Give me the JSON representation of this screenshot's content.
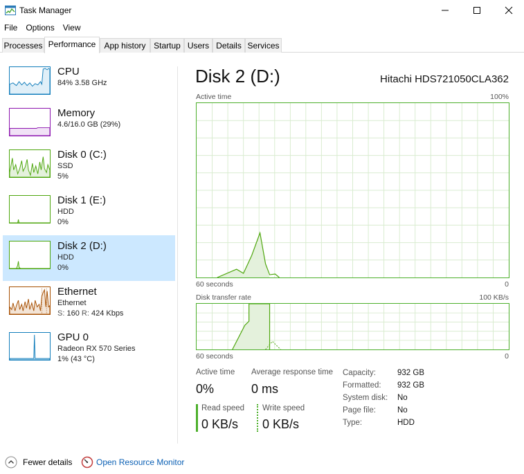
{
  "window": {
    "title": "Task Manager",
    "icon": "task-manager-icon",
    "controls": [
      "minimize-icon",
      "maximize-icon",
      "close-icon"
    ]
  },
  "menu": [
    "File",
    "Options",
    "View"
  ],
  "tabs": [
    "Processes",
    "Performance",
    "App history",
    "Startup",
    "Users",
    "Details",
    "Services"
  ],
  "active_tab": "Performance",
  "sidebar": [
    {
      "title": "CPU",
      "line1": "84%  3.58 GHz",
      "line2": "",
      "color": "#117dbb"
    },
    {
      "title": "Memory",
      "line1": "4.6/16.0 GB (29%)",
      "line2": "",
      "color": "#8b12ae"
    },
    {
      "title": "Disk 0 (C:)",
      "line1": "SSD",
      "line2": "5%",
      "color": "#4da60c"
    },
    {
      "title": "Disk 1 (E:)",
      "line1": "HDD",
      "line2": "0%",
      "color": "#4da60c"
    },
    {
      "title": "Disk 2 (D:)",
      "line1": "HDD",
      "line2": "0%",
      "color": "#4da60c",
      "selected": true
    },
    {
      "title": "Ethernet",
      "line1": "Ethernet",
      "line2_s_label": "S:",
      "line2_s": "160",
      "line2_r_label": "R:",
      "line2_r": "424 Kbps",
      "color": "#a74f01"
    },
    {
      "title": "GPU 0",
      "line1": "Radeon RX 570 Series",
      "line2": "1%  (43 °C)",
      "color": "#117dbb"
    }
  ],
  "main": {
    "title": "Disk 2 (D:)",
    "device": "Hitachi HDS721050CLA362",
    "active_graph": {
      "label": "Active time",
      "max": "100%",
      "time_label": "60 seconds",
      "min": "0"
    },
    "transfer_graph": {
      "label": "Disk transfer rate",
      "max": "100 KB/s",
      "time_label": "60 seconds",
      "min": "0"
    },
    "stats": {
      "active_time_label": "Active time",
      "active_time_value": "0%",
      "avg_response_label": "Average response time",
      "avg_response_value": "0 ms",
      "read_label": "Read speed",
      "read_value": "0 KB/s",
      "write_label": "Write speed",
      "write_value": "0 KB/s"
    },
    "properties": [
      {
        "label": "Capacity:",
        "value": "932 GB"
      },
      {
        "label": "Formatted:",
        "value": "932 GB"
      },
      {
        "label": "System disk:",
        "value": "No"
      },
      {
        "label": "Page file:",
        "value": "No"
      },
      {
        "label": "Type:",
        "value": "HDD"
      }
    ]
  },
  "footer": {
    "fewer_details": "Fewer details",
    "open_resource_monitor": "Open Resource Monitor"
  },
  "colors": {
    "disk": "#4da60c",
    "cpu": "#117dbb",
    "memory": "#8b12ae",
    "ethernet": "#a74f01",
    "selected": "#cce8ff",
    "link": "#0a5fb4"
  }
}
